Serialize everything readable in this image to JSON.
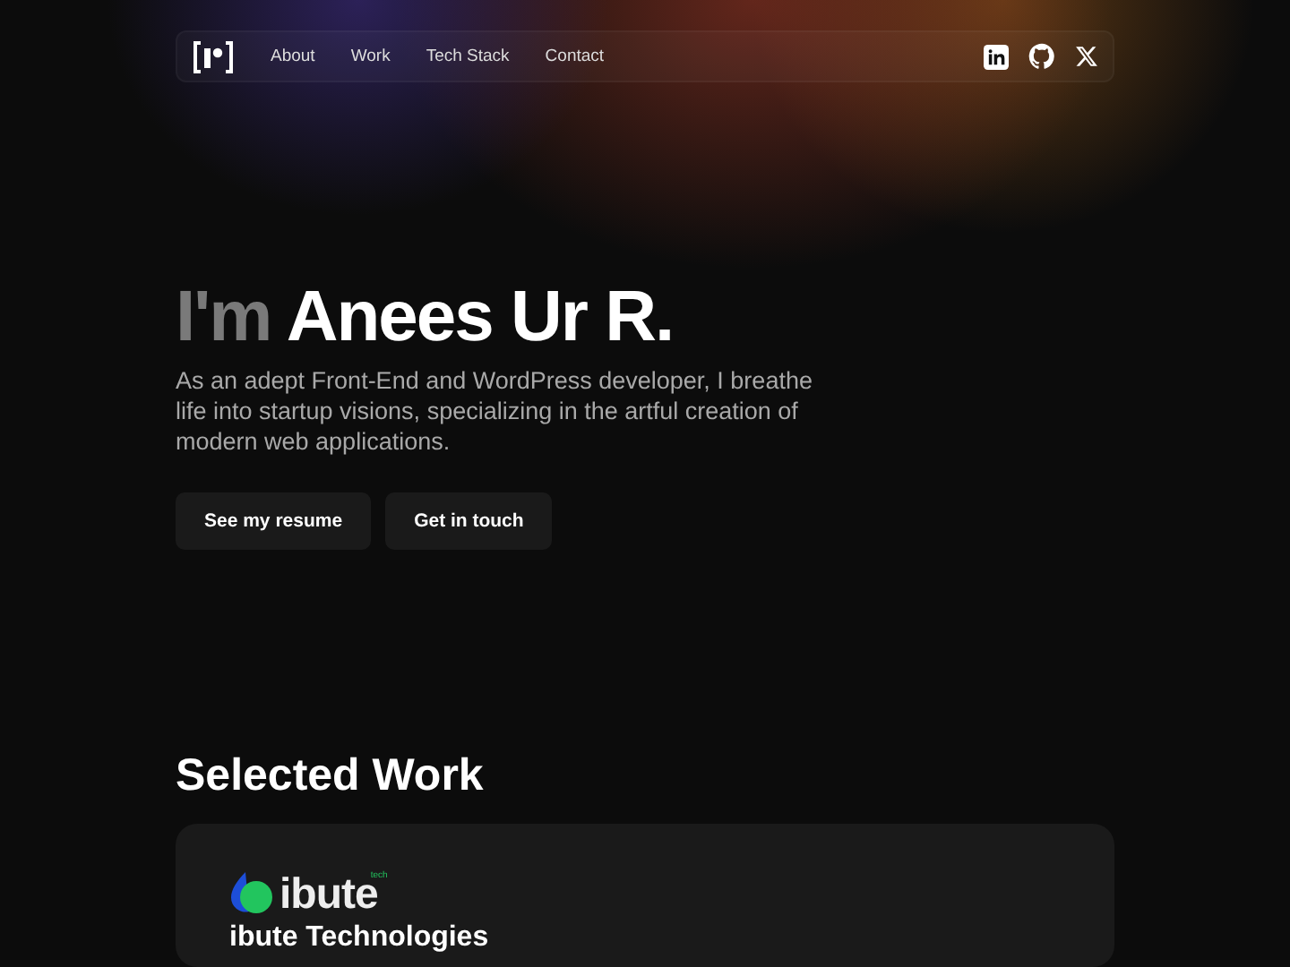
{
  "nav": {
    "links": [
      {
        "label": "About"
      },
      {
        "label": "Work"
      },
      {
        "label": "Tech Stack"
      },
      {
        "label": "Contact"
      }
    ],
    "social": [
      {
        "kind": "linkedin"
      },
      {
        "kind": "github"
      },
      {
        "kind": "x"
      }
    ]
  },
  "hero": {
    "intro": "I'm",
    "name": "Anees Ur R.",
    "description": "As an adept Front-End and WordPress developer, I breathe life into startup visions, specializing in the artful creation of modern web applications.",
    "buttons": [
      "See my resume",
      "Get in touch"
    ]
  },
  "work": {
    "heading": "Selected Work",
    "projects": [
      {
        "logo_text": "ibute",
        "logo_tag": "tech",
        "title": "ibute Technologies"
      }
    ]
  }
}
